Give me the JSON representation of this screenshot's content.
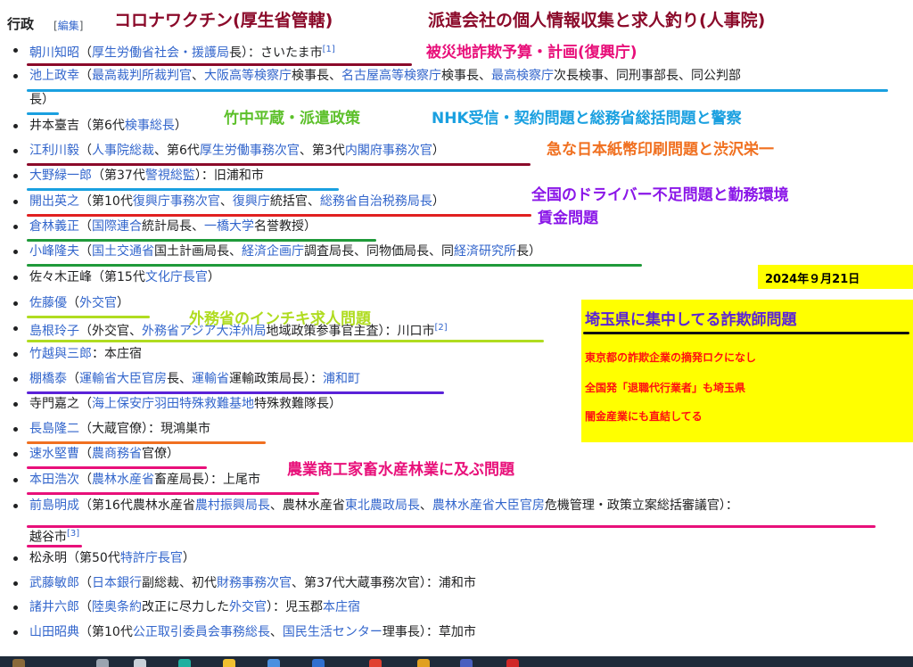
{
  "section": {
    "heading": "行政",
    "edit_prefix": "[",
    "edit_label": "編集",
    "edit_suffix": "]"
  },
  "rows": [
    {
      "parts": [
        {
          "t": "朝川知昭",
          "l": true
        },
        {
          "t": "（"
        },
        {
          "t": "厚生労働省社会・援護局",
          "l": true
        },
        {
          "t": "長）：さいたま市"
        },
        {
          "t": "[1]",
          "s": true
        }
      ]
    },
    {
      "parts": [
        {
          "t": "池上政幸",
          "l": true
        },
        {
          "t": "（"
        },
        {
          "t": "最高裁判所裁判官",
          "l": true
        },
        {
          "t": "、"
        },
        {
          "t": "大阪高等検察庁",
          "l": true
        },
        {
          "t": "検事長、"
        },
        {
          "t": "名古屋高等検察庁",
          "l": true
        },
        {
          "t": "検事長、"
        },
        {
          "t": "最高検察庁",
          "l": true
        },
        {
          "t": "次長検事、同刑事部長、同公判部"
        }
      ]
    },
    {
      "parts": [
        {
          "t": "長）"
        }
      ]
    },
    {
      "parts": [
        {
          "t": "井本臺吉（第6代"
        },
        {
          "t": "検事総長",
          "l": true
        },
        {
          "t": "）"
        }
      ]
    },
    {
      "parts": [
        {
          "t": "江利川毅",
          "l": true
        },
        {
          "t": "（"
        },
        {
          "t": "人事院総裁",
          "l": true
        },
        {
          "t": "、第6代"
        },
        {
          "t": "厚生労働事務次官",
          "l": true
        },
        {
          "t": "、第3代"
        },
        {
          "t": "内閣府事務次官",
          "l": true
        },
        {
          "t": "）"
        }
      ]
    },
    {
      "parts": [
        {
          "t": "大野緑一郎",
          "l": true
        },
        {
          "t": "（第37代"
        },
        {
          "t": "警視総監",
          "l": true
        },
        {
          "t": "）：旧浦和市"
        }
      ]
    },
    {
      "parts": [
        {
          "t": "開出英之",
          "l": true
        },
        {
          "t": "（第10代"
        },
        {
          "t": "復興庁事務次官",
          "l": true
        },
        {
          "t": "、"
        },
        {
          "t": "復興庁",
          "l": true
        },
        {
          "t": "統括官、"
        },
        {
          "t": "総務省自治税務局長",
          "l": true
        },
        {
          "t": "）"
        }
      ]
    },
    {
      "parts": [
        {
          "t": "倉林義正",
          "l": true
        },
        {
          "t": "（"
        },
        {
          "t": "国際連合",
          "l": true
        },
        {
          "t": "統計局長、"
        },
        {
          "t": "一橋大学",
          "l": true
        },
        {
          "t": "名誉教授）"
        }
      ]
    },
    {
      "parts": [
        {
          "t": "小峰隆夫",
          "l": true
        },
        {
          "t": "（"
        },
        {
          "t": "国土交通省",
          "l": true
        },
        {
          "t": "国土計画局長、"
        },
        {
          "t": "経済企画庁",
          "l": true
        },
        {
          "t": "調査局長、同物価局長、同"
        },
        {
          "t": "経済研究所",
          "l": true
        },
        {
          "t": "長）"
        }
      ]
    },
    {
      "parts": [
        {
          "t": "佐々木正峰（第15代"
        },
        {
          "t": "文化庁長官",
          "l": true
        },
        {
          "t": "）"
        }
      ]
    },
    {
      "parts": [
        {
          "t": "佐藤優",
          "l": true
        },
        {
          "t": "（"
        },
        {
          "t": "外交官",
          "l": true
        },
        {
          "t": "）"
        }
      ]
    },
    {
      "parts": [
        {
          "t": "島根玲子",
          "l": true
        },
        {
          "t": "（外交官、"
        },
        {
          "t": "外務省アジア大洋州局",
          "l": true
        },
        {
          "t": "地域政策参事官主査）：川口市"
        },
        {
          "t": "[2]",
          "s": true
        }
      ]
    },
    {
      "parts": [
        {
          "t": "竹越與三郎",
          "l": true
        },
        {
          "t": "：本庄宿"
        }
      ]
    },
    {
      "parts": [
        {
          "t": "棚橋泰",
          "l": true
        },
        {
          "t": "（"
        },
        {
          "t": "運輸省大臣官房",
          "l": true
        },
        {
          "t": "長、"
        },
        {
          "t": "運輸省",
          "l": true
        },
        {
          "t": "運輸政策局長）："
        },
        {
          "t": "浦和町",
          "l": true
        }
      ]
    },
    {
      "parts": [
        {
          "t": "寺門嘉之（"
        },
        {
          "t": "海上保安庁羽田特殊救難基地",
          "l": true
        },
        {
          "t": "特殊救難隊長）"
        }
      ]
    },
    {
      "parts": [
        {
          "t": "長島隆二",
          "l": true
        },
        {
          "t": "（大蔵官僚）：現鴻巣市"
        }
      ]
    },
    {
      "parts": [
        {
          "t": "速水堅曹",
          "l": true
        },
        {
          "t": "（"
        },
        {
          "t": "農商務省",
          "l": true
        },
        {
          "t": "官僚）"
        }
      ]
    },
    {
      "parts": [
        {
          "t": "本田浩次",
          "l": true
        },
        {
          "t": "（"
        },
        {
          "t": "農林水産省",
          "l": true
        },
        {
          "t": "畜産局長）：上尾市"
        }
      ]
    },
    {
      "parts": [
        {
          "t": "前島明成",
          "l": true
        },
        {
          "t": "（第16代農林水産省"
        },
        {
          "t": "農村振興局長",
          "l": true
        },
        {
          "t": "、農林水産省"
        },
        {
          "t": "東北農政局長",
          "l": true
        },
        {
          "t": "、"
        },
        {
          "t": "農林水産省大臣官房",
          "l": true
        },
        {
          "t": "危機管理・政策立案総括審議官）："
        }
      ]
    },
    {
      "parts": [
        {
          "t": "越谷市"
        },
        {
          "t": "[3]",
          "s": true
        }
      ]
    },
    {
      "parts": [
        {
          "t": "松永明（第50代"
        },
        {
          "t": "特許庁長官",
          "l": true
        },
        {
          "t": "）"
        }
      ]
    },
    {
      "parts": [
        {
          "t": "武藤敏郎",
          "l": true
        },
        {
          "t": "（"
        },
        {
          "t": "日本銀行",
          "l": true
        },
        {
          "t": "副総裁、初代"
        },
        {
          "t": "財務事務次官",
          "l": true
        },
        {
          "t": "、第37代大蔵事務次官）：浦和市"
        }
      ]
    },
    {
      "parts": [
        {
          "t": "諸井六郎",
          "l": true
        },
        {
          "t": "（"
        },
        {
          "t": "陸奥条約",
          "l": true
        },
        {
          "t": "改正に尽力した"
        },
        {
          "t": "外交官",
          "l": true
        },
        {
          "t": "）：児玉郡"
        },
        {
          "t": "本庄宿",
          "l": true
        }
      ]
    },
    {
      "parts": [
        {
          "t": "山田昭典",
          "l": true
        },
        {
          "t": "（第10代"
        },
        {
          "t": "公正取引委員会事務総長",
          "l": true
        },
        {
          "t": "、"
        },
        {
          "t": "国民生活センター",
          "l": true
        },
        {
          "t": "理事長）：草加市"
        }
      ]
    }
  ],
  "annotations": {
    "a1": "コロナワクチン(厚生省管轄)",
    "a2": "派遣会社の個人情報収集と求人釣り(人事院)",
    "a3": "被災地詐欺予算・計画(復興庁)",
    "a4": "竹中平蔵・派遣政策",
    "a5": "NHK受信・契約問題と総務省総括問題と警察",
    "a6": "急な日本紙幣印刷問題と渋沢栄一",
    "a7": "全国のドライバー不足問題と勤務環境",
    "a8": "賃金問題",
    "a9": "外務省のインチキ求人問題",
    "a10": "農業商工家畜水産林業に及ぶ問題"
  },
  "date_box": "2024年９月21日",
  "info_box": {
    "title": "埼玉県に集中してる詐欺師問題",
    "line1": "東京都の詐欺企業の摘発ロクになし",
    "line2": "全国発「退職代行業者」も埼玉県",
    "line3": "闇金産業にも直結してる"
  },
  "colors": {
    "link": "#3366cc",
    "maroon": "#8b0a2a",
    "pink": "#e8107a",
    "green": "#5cc02a",
    "cyan": "#1aa0e0",
    "orange": "#f07020",
    "purple": "#8a16e8",
    "red": "#e02020",
    "yellow": "#ffff00",
    "lime": "#b0dc20",
    "boxred": "#ff1010",
    "navy": "#5a22d8"
  }
}
